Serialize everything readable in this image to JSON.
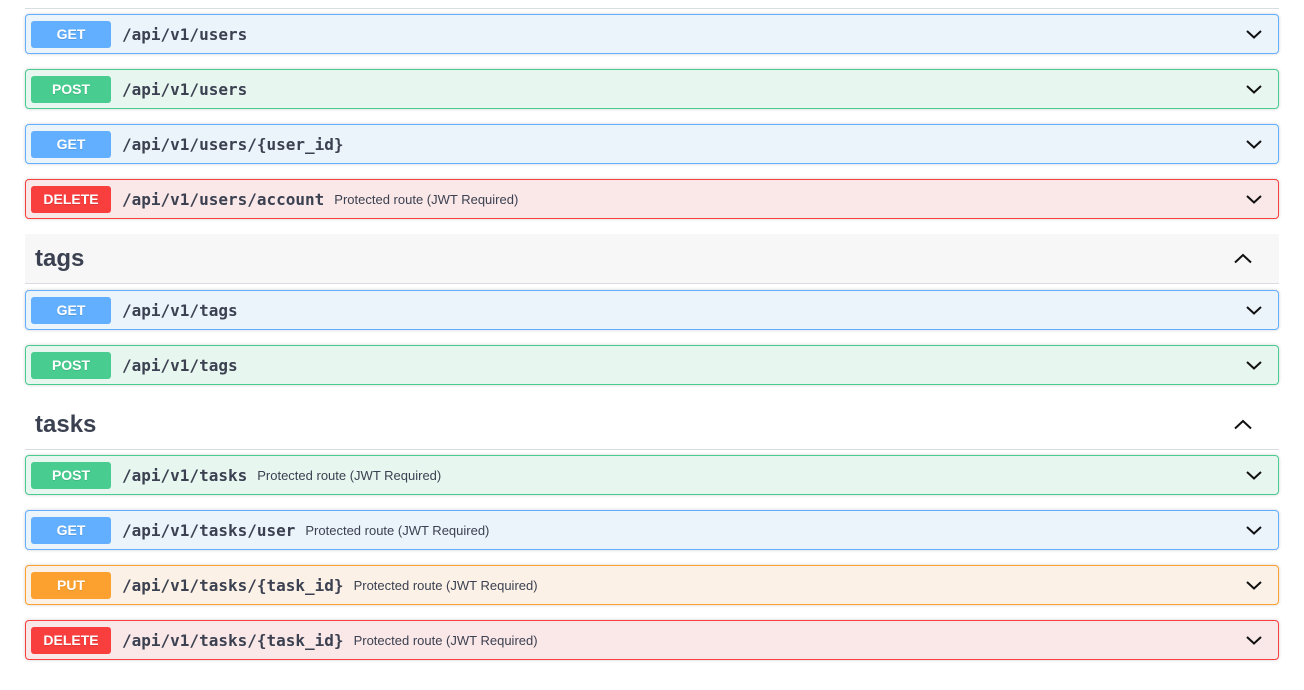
{
  "sections": [
    {
      "tag": null,
      "operations": [
        {
          "method": "GET",
          "path": "/api/v1/users",
          "summary": ""
        },
        {
          "method": "POST",
          "path": "/api/v1/users",
          "summary": ""
        },
        {
          "method": "GET",
          "path": "/api/v1/users/{user_id}",
          "summary": ""
        },
        {
          "method": "DELETE",
          "path": "/api/v1/users/account",
          "summary": "Protected route (JWT Required)"
        }
      ]
    },
    {
      "tag": "tags",
      "expanded": true,
      "operations": [
        {
          "method": "GET",
          "path": "/api/v1/tags",
          "summary": ""
        },
        {
          "method": "POST",
          "path": "/api/v1/tags",
          "summary": ""
        }
      ]
    },
    {
      "tag": "tasks",
      "expanded": true,
      "operations": [
        {
          "method": "POST",
          "path": "/api/v1/tasks",
          "summary": "Protected route (JWT Required)"
        },
        {
          "method": "GET",
          "path": "/api/v1/tasks/user",
          "summary": "Protected route (JWT Required)"
        },
        {
          "method": "PUT",
          "path": "/api/v1/tasks/{task_id}",
          "summary": "Protected route (JWT Required)"
        },
        {
          "method": "DELETE",
          "path": "/api/v1/tasks/{task_id}",
          "summary": "Protected route (JWT Required)"
        }
      ]
    }
  ],
  "icons": {
    "operation_toggle": "chevron-down-icon",
    "tag_toggle": "chevron-up-icon"
  },
  "colors": {
    "GET": "#61affe",
    "POST": "#49cc90",
    "DELETE": "#f93e3e",
    "PUT": "#fca130"
  }
}
